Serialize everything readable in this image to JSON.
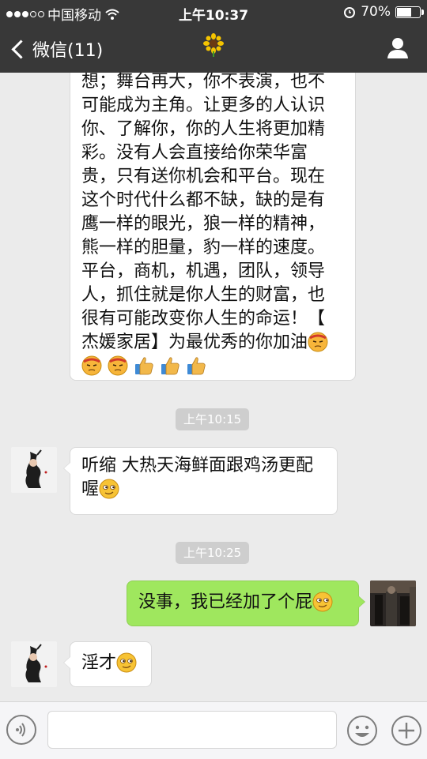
{
  "status_bar": {
    "carrier": "中国移动",
    "time": "上午10:37",
    "battery": "70%",
    "battery_level": 0.7
  },
  "nav": {
    "back_label": "微信(11)",
    "center_icon": "sunflower-icon",
    "right_icon": "user-icon"
  },
  "messages": [
    {
      "side": "left",
      "text_lines": [
        "想；舞台再大，你不表演，也不",
        "可能成为主角。让更多的人认识",
        "你、了解你，你的人生将更加精",
        "彩。没有人会直接给你荣华富",
        "贵，只有送你机会和平台。现在",
        "这个时代什么都不缺，缺的是有",
        "鹰一样的眼光，狼一样的精神，",
        "熊一样的胆量，豹一样的速度。",
        "平台，商机，机遇，团队，领导",
        "人，抓住就是你人生的财富，也",
        "很有可能改变你人生的命运！【",
        "杰媛家居】为最优秀的你加油"
      ]
    },
    {
      "type": "time",
      "text": "上午10:15"
    },
    {
      "side": "left",
      "line1": "听缩 大热天海鲜面跟鸡汤更配",
      "line2": "喔"
    },
    {
      "type": "time",
      "text": "上午10:25"
    },
    {
      "side": "right",
      "text": "没事，我已经加了个屁"
    },
    {
      "side": "left",
      "text": "淫才"
    }
  ],
  "input_bar": {
    "voice_icon": "voice-icon",
    "emoji_icon": "emoji-icon",
    "plus_icon": "plus-icon"
  }
}
